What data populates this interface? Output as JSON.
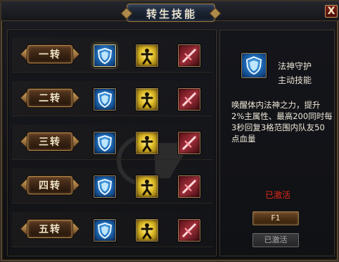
{
  "window": {
    "title": "转生技能",
    "close_label": "X"
  },
  "ranks": [
    {
      "label": "一转"
    },
    {
      "label": "二转"
    },
    {
      "label": "三转"
    },
    {
      "label": "四转"
    },
    {
      "label": "五转"
    }
  ],
  "skill_icons": [
    "shield-skill-icon",
    "monk-skill-icon",
    "blade-skill-icon"
  ],
  "detail": {
    "icon": "shield-skill-icon",
    "name": "法神守护",
    "type": "主动技能",
    "description": "唤醒体内法神之力，提升2%主属性、最高200同时每3秒回复3格范围内队友50点血量",
    "status": "已激活",
    "hotkey_button": "F1",
    "activated_button": "已激活"
  },
  "colors": {
    "status_red": "#e0281a",
    "frame_gold": "#9a7a44"
  }
}
